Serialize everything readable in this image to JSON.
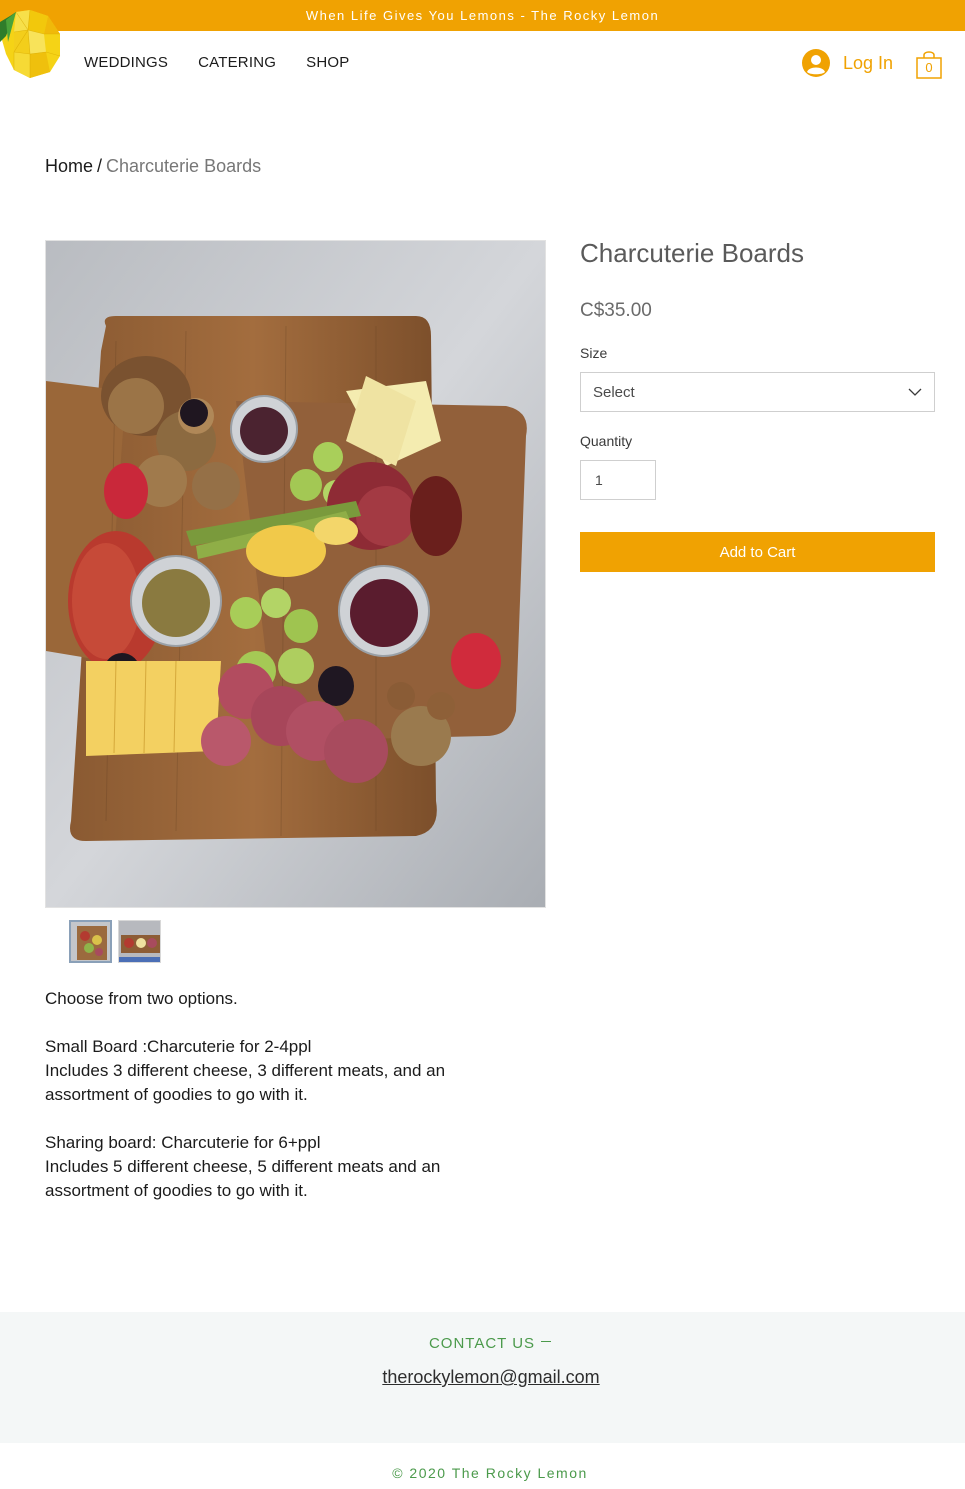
{
  "announcement": "When Life Gives You Lemons - The Rocky Lemon",
  "nav": {
    "items": [
      {
        "label": "WEDDINGS"
      },
      {
        "label": "CATERING"
      },
      {
        "label": "SHOP"
      }
    ]
  },
  "header": {
    "login_label": "Log In",
    "cart_count": "0",
    "logo_icon": "lemon-logo-icon",
    "avatar_icon": "user-avatar-icon",
    "cart_icon": "shopping-bag-icon"
  },
  "breadcrumb": {
    "home": "Home",
    "separator": "/",
    "current": "Charcuterie Boards"
  },
  "product": {
    "title": "Charcuterie Boards",
    "price": "C$35.00",
    "size_label": "Size",
    "size_placeholder": "Select",
    "quantity_label": "Quantity",
    "quantity_value": "1",
    "add_to_cart_label": "Add to Cart"
  },
  "description": [
    "Choose from two options.",
    "",
    "Small Board :Charcuterie for 2-4ppl",
    "Includes 3 different cheese, 3 different meats, and an assortment of goodies to go with it.",
    "",
    "Sharing board: Charcuterie for 6+ppl",
    "Includes 5 different cheese, 5 different meats and an assortment of goodies to go with it."
  ],
  "footer": {
    "contact_title": "CONTACT US",
    "email": "therockylemon@gmail.com",
    "copyright": "© 2020 The Rocky Lemon"
  },
  "colors": {
    "accent": "#f0a202",
    "footer_green": "#4b9a4b"
  }
}
